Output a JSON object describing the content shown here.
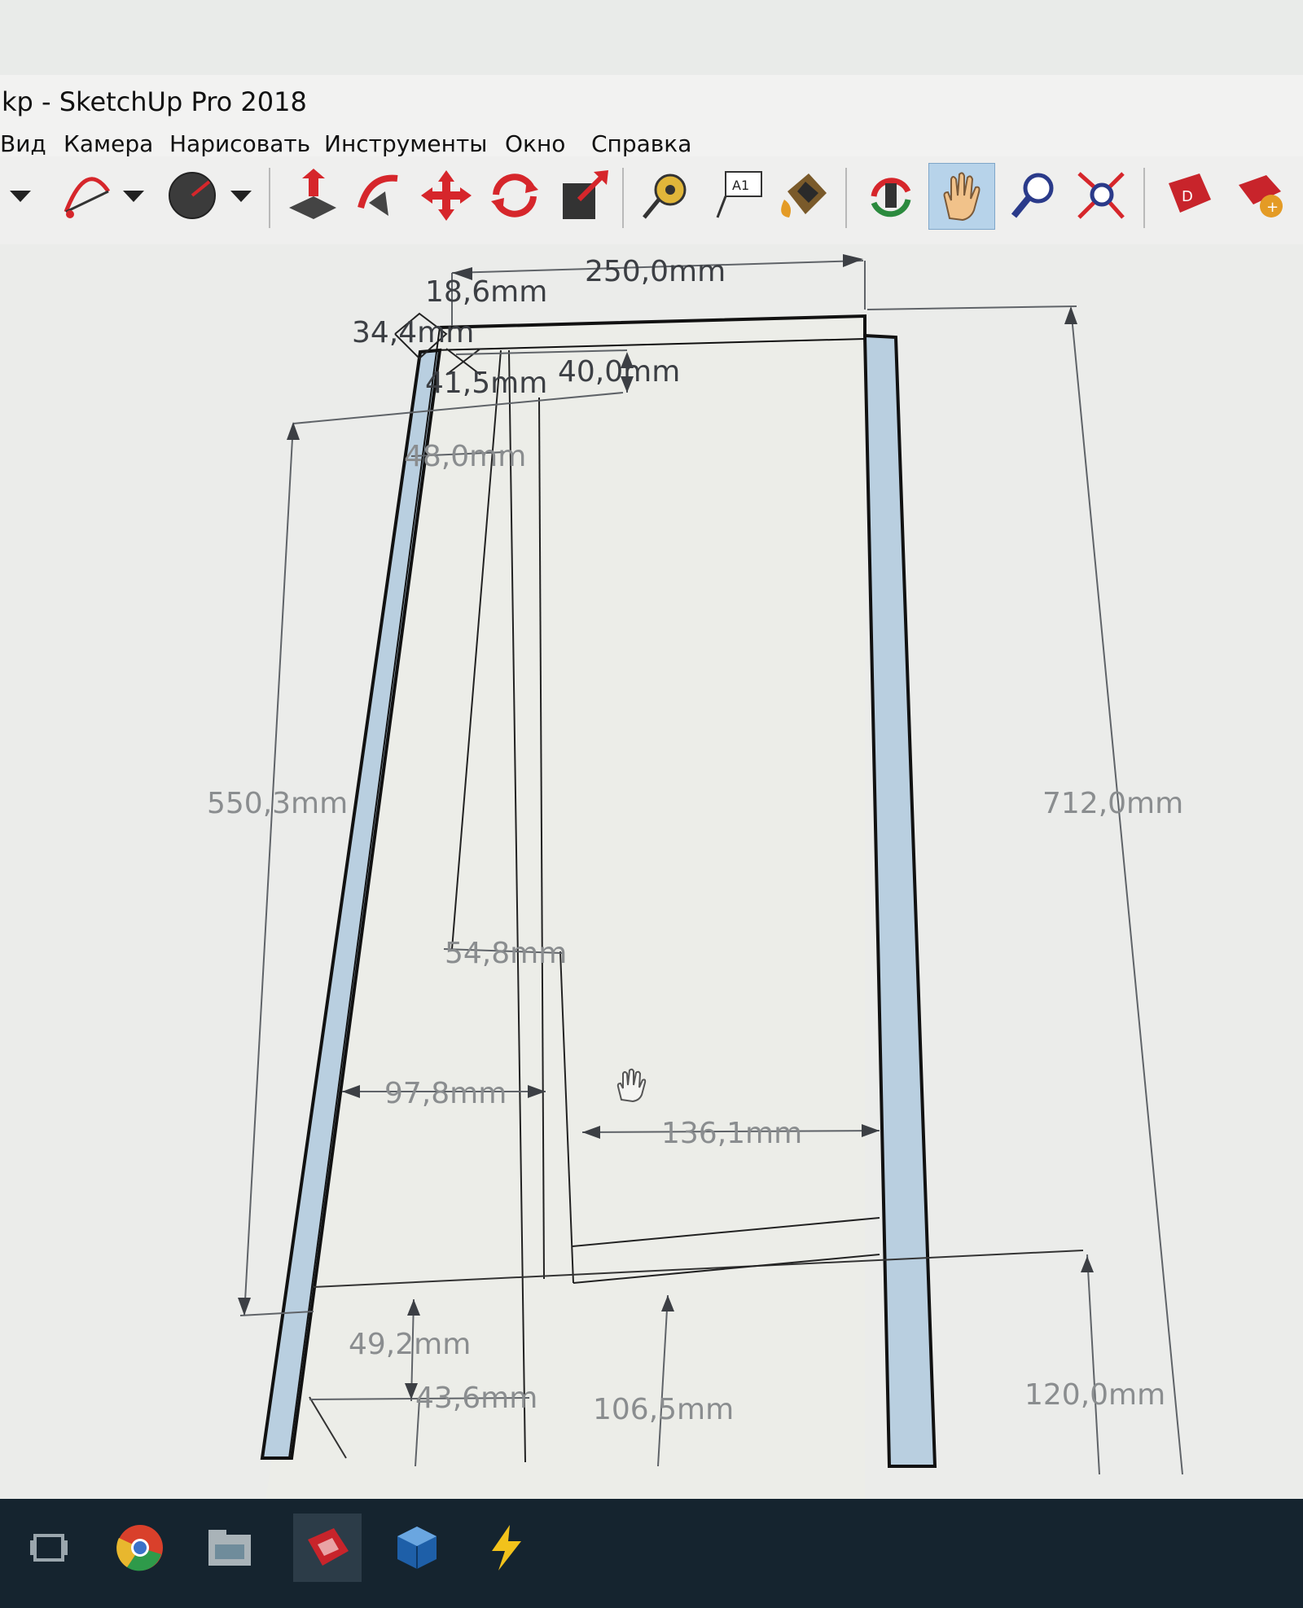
{
  "window": {
    "title": "kp - SketchUp Pro 2018"
  },
  "menu": {
    "items": [
      "Вид",
      "Камера",
      "Нарисовать",
      "Инструменты",
      "Окно",
      "Справка"
    ]
  },
  "toolbar": {
    "tools": [
      {
        "name": "dropdown-arrow-icon"
      },
      {
        "name": "arc-tool-icon"
      },
      {
        "name": "dropdown-arrow-icon"
      },
      {
        "name": "pie-tool-icon"
      },
      {
        "name": "dropdown-arrow-icon"
      },
      {
        "name": "push-pull-icon"
      },
      {
        "name": "follow-me-icon"
      },
      {
        "name": "move-icon"
      },
      {
        "name": "rotate-icon"
      },
      {
        "name": "scale-icon"
      },
      {
        "name": "tape-measure-icon"
      },
      {
        "name": "text-label-icon",
        "label": "A1"
      },
      {
        "name": "paint-bucket-icon"
      },
      {
        "name": "orbit-icon"
      },
      {
        "name": "pan-hand-icon",
        "active": true
      },
      {
        "name": "zoom-icon"
      },
      {
        "name": "zoom-extents-icon"
      },
      {
        "name": "3d-warehouse-icon"
      },
      {
        "name": "extension-warehouse-icon"
      }
    ]
  },
  "dimensions": {
    "top_width": "250,0mm",
    "d_18_6": "18,6mm",
    "d_34_4": "34,4mm",
    "d_40_0": "40,0mm",
    "d_41_5": "41,5mm",
    "d_48_0": "48,0mm",
    "d_550_3": "550,3mm",
    "d_712_0": "712,0mm",
    "d_54_8": "54,8mm",
    "d_97_8": "97,8mm",
    "d_136_1": "136,1mm",
    "d_49_2": "49,2mm",
    "d_43_6": "43,6mm",
    "d_106_5": "106,5mm",
    "d_120_0": "120,0mm"
  },
  "taskbar": {
    "items": [
      {
        "name": "task-view-icon"
      },
      {
        "name": "chrome-icon"
      },
      {
        "name": "file-explorer-icon"
      },
      {
        "name": "sketchup-icon"
      },
      {
        "name": "virtualbox-icon"
      },
      {
        "name": "lightning-app-icon"
      }
    ]
  },
  "colors": {
    "panel_blue": "#b9cfe0",
    "edge": "#111111",
    "dimension": "#8a8d8f",
    "active_tool": "#b7d3ea"
  }
}
